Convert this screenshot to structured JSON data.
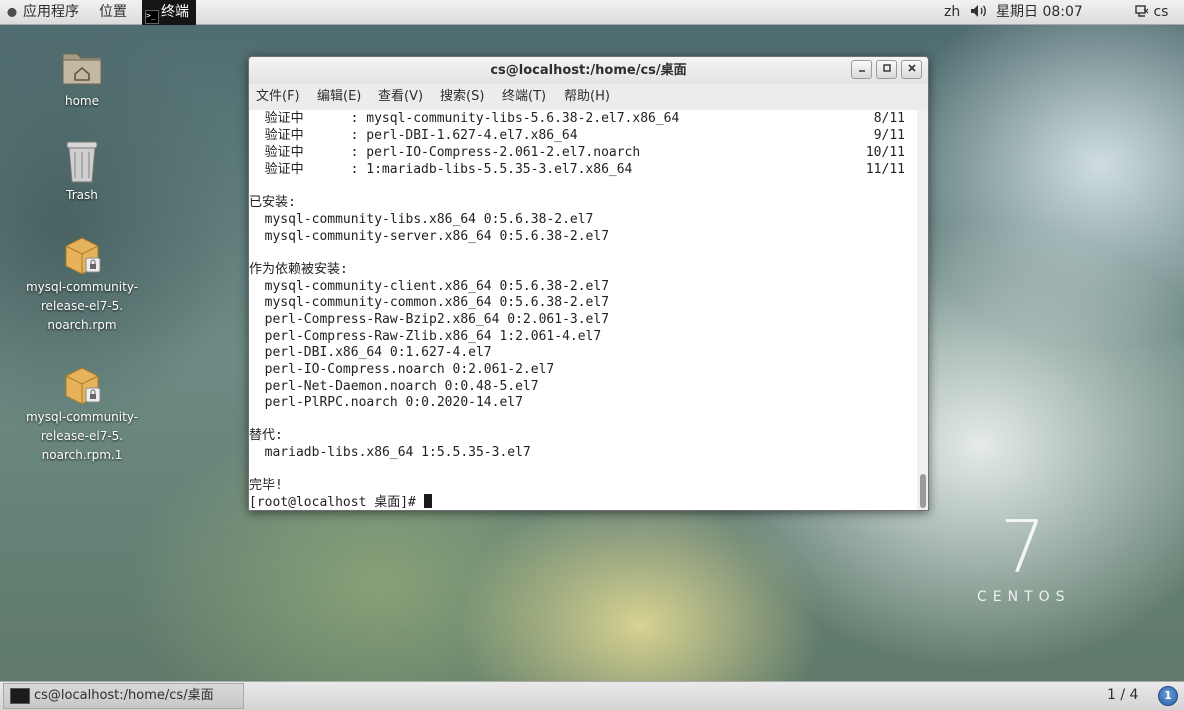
{
  "top_panel": {
    "apps_menu": "应用程序",
    "places_menu": "位置",
    "active_task": "终端",
    "input_method": "zh",
    "volume_icon": "speaker-icon",
    "clock": "星期日 08:07",
    "user": "cs"
  },
  "desktop": {
    "icons": [
      {
        "label": "home",
        "icon": "home-folder-icon"
      },
      {
        "label": "Trash",
        "icon": "trash-icon"
      },
      {
        "label_lines": [
          "mysql-community-",
          "release-el7-5.",
          "noarch.rpm"
        ],
        "icon": "package-icon"
      },
      {
        "label_lines": [
          "mysql-community-",
          "release-el7-5.",
          "noarch.rpm.1"
        ],
        "icon": "package-icon"
      }
    ],
    "logo_number": "7",
    "logo_text": "CENTOS"
  },
  "terminal": {
    "title": "cs@localhost:/home/cs/桌面",
    "menu": [
      "文件(F)",
      "编辑(E)",
      "查看(V)",
      "搜索(S)",
      "终端(T)",
      "帮助(H)"
    ],
    "verify_lines": [
      {
        "text": "  验证中      : mysql-community-libs-5.6.38-2.el7.x86_64",
        "count": "8/11"
      },
      {
        "text": "  验证中      : perl-DBI-1.627-4.el7.x86_64",
        "count": "9/11"
      },
      {
        "text": "  验证中      : perl-IO-Compress-2.061-2.el7.noarch",
        "count": "10/11"
      },
      {
        "text": "  验证中      : 1:mariadb-libs-5.5.35-3.el7.x86_64",
        "count": "11/11"
      }
    ],
    "installed_header": "已安装:",
    "installed": [
      "  mysql-community-libs.x86_64 0:5.6.38-2.el7",
      "  mysql-community-server.x86_64 0:5.6.38-2.el7"
    ],
    "deps_header": "作为依赖被安装:",
    "deps": [
      "  mysql-community-client.x86_64 0:5.6.38-2.el7",
      "  mysql-community-common.x86_64 0:5.6.38-2.el7",
      "  perl-Compress-Raw-Bzip2.x86_64 0:2.061-3.el7",
      "  perl-Compress-Raw-Zlib.x86_64 1:2.061-4.el7",
      "  perl-DBI.x86_64 0:1.627-4.el7",
      "  perl-IO-Compress.noarch 0:2.061-2.el7",
      "  perl-Net-Daemon.noarch 0:0.48-5.el7",
      "  perl-PlRPC.noarch 0:0.2020-14.el7"
    ],
    "replaced_header": "替代:",
    "replaced": [
      "  mariadb-libs.x86_64 1:5.5.35-3.el7"
    ],
    "done": "完毕!",
    "prompt": "[root@localhost 桌面]# "
  },
  "bottom_panel": {
    "task_title": "cs@localhost:/home/cs/桌面",
    "workspace": "1 / 4",
    "notification_count": "1"
  }
}
